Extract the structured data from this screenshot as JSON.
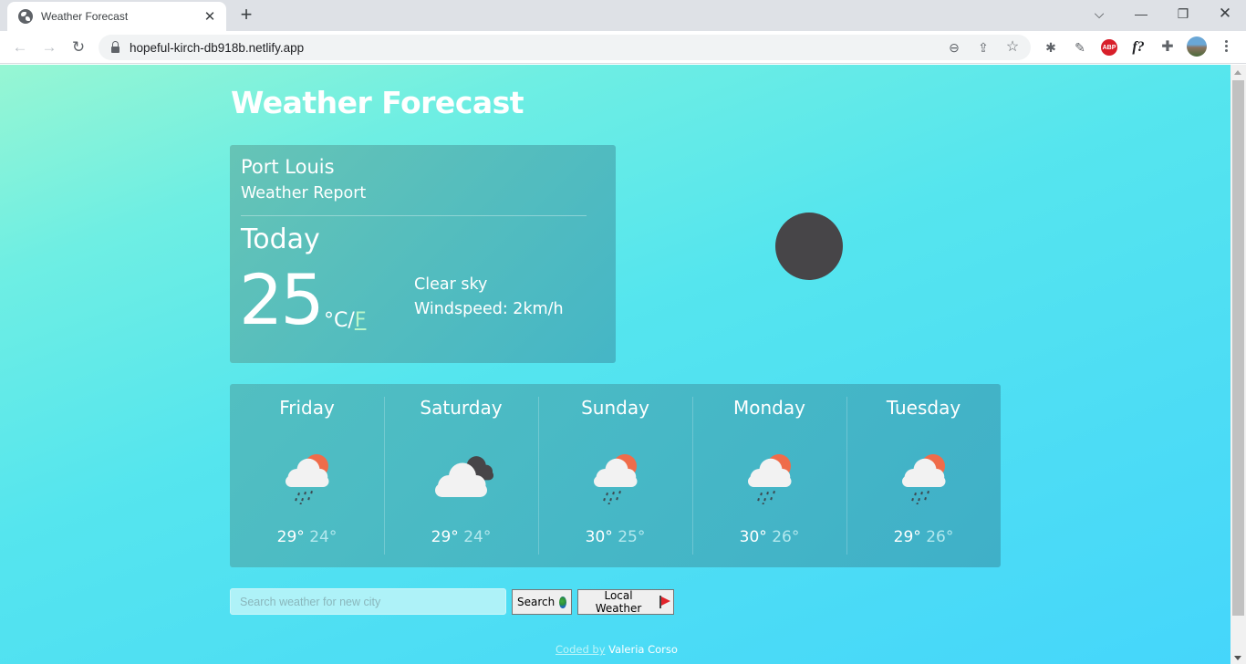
{
  "browser": {
    "tab_title": "Weather Forecast",
    "url": "hopeful-kirch-db918b.netlify.app",
    "icons": {
      "tab_favicon": "globe-icon",
      "close_tab": "close-icon",
      "new_tab": "plus-icon",
      "tab_search": "chevron-down-icon",
      "minimize": "minimize-icon",
      "restore": "restore-icon",
      "close_window": "close-icon",
      "back": "arrow-left-icon",
      "forward": "arrow-right-icon",
      "reload": "reload-icon",
      "lock": "lock-icon",
      "zoom": "zoom-out-icon",
      "share": "share-icon",
      "bookmark": "star-icon",
      "ext_bug": "bug-icon",
      "ext_eyedropper": "eyedropper-icon",
      "ext_abp": "adblock-icon",
      "ext_font": "font-icon",
      "extensions": "puzzle-icon",
      "profile": "avatar",
      "menu": "more-vert-icon"
    },
    "abp_label": "ABP",
    "font_ext_label": "f?"
  },
  "page": {
    "title": "Weather Forecast",
    "today": {
      "city": "Port Louis",
      "subtitle": "Weather Report",
      "label": "Today",
      "temperature": "25",
      "unit_celsius": "°C",
      "unit_separator": "/",
      "unit_fahrenheit": "F",
      "description": "Clear sky",
      "windspeed": "Windspeed: 2km/h",
      "icon": "clear-night-icon",
      "icon_color": "#474548"
    },
    "forecast": [
      {
        "day": "Friday",
        "max": "29°",
        "min": "24°",
        "icon": "rain-sun-icon"
      },
      {
        "day": "Saturday",
        "max": "29°",
        "min": "24°",
        "icon": "cloudy-icon"
      },
      {
        "day": "Sunday",
        "max": "30°",
        "min": "25°",
        "icon": "rain-sun-icon"
      },
      {
        "day": "Monday",
        "max": "30°",
        "min": "26°",
        "icon": "rain-sun-icon"
      },
      {
        "day": "Tuesday",
        "max": "29°",
        "min": "26°",
        "icon": "rain-sun-icon"
      }
    ],
    "search": {
      "placeholder": "Search weather for new city",
      "value": "",
      "button_label": "Search",
      "button_icon": "globe-icon",
      "local_label": "Local Weather",
      "local_icon": "flag-icon"
    },
    "footer": {
      "link_text": "Coded by",
      "author": " Valeria Corso"
    },
    "colors": {
      "sun": "#ef6c4a",
      "dark_cloud": "#474548",
      "cloud": "#f2f2f2",
      "rain": "#3c4a52"
    }
  }
}
